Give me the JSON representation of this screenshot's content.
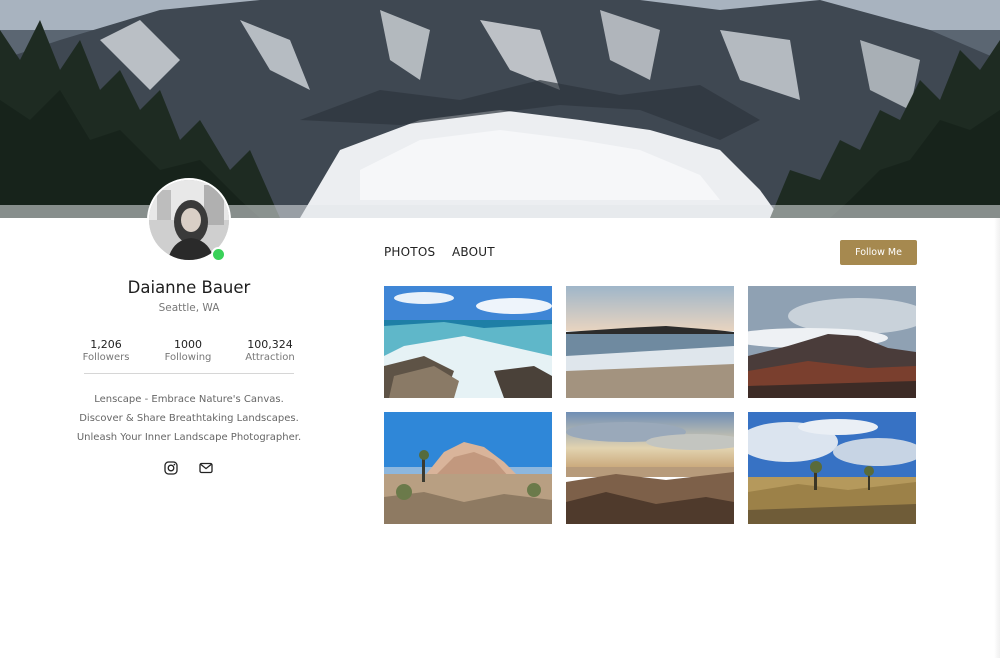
{
  "profile": {
    "name": "Daianne Bauer",
    "location": "Seattle, WA",
    "status": "online",
    "stats": [
      {
        "value": "1,206",
        "label": "Followers"
      },
      {
        "value": "1000",
        "label": "Following"
      },
      {
        "value": "100,324",
        "label": "Attraction"
      }
    ],
    "bio": [
      "Lenscape - Embrace Nature's Canvas.",
      "Discover & Share Breathtaking Landscapes.",
      "Unleash Your Inner Landscape Photographer."
    ],
    "social": [
      "instagram-icon",
      "mail-icon"
    ]
  },
  "tabs": [
    {
      "label": "PHOTOS"
    },
    {
      "label": "ABOUT"
    }
  ],
  "follow_label": "Follow Me",
  "colors": {
    "accent": "#a6894f",
    "online": "#3ad159",
    "text": "#222222",
    "muted": "#777777"
  },
  "photos": [
    {
      "subject": "rocky coastline with turquoise waves"
    },
    {
      "subject": "beach at sunset with rocks on horizon"
    },
    {
      "subject": "volcanic mountain above clouds"
    },
    {
      "subject": "desert rock formation with joshua trees"
    },
    {
      "subject": "desert valley at sunset"
    },
    {
      "subject": "joshua tree desert under cloudy sky"
    }
  ]
}
